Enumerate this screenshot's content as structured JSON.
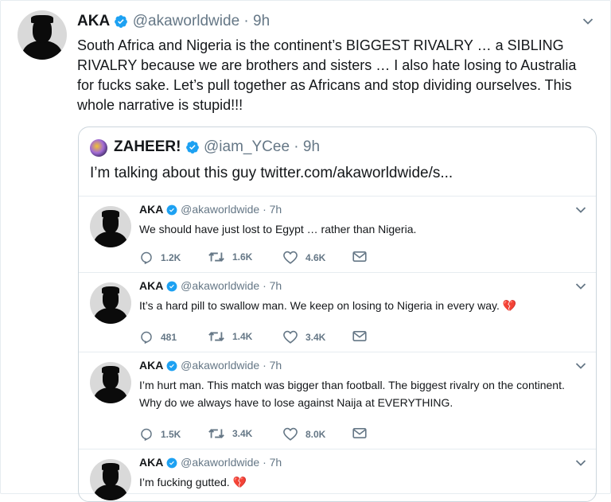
{
  "main_tweet": {
    "name": "AKA",
    "handle": "@akaworldwide",
    "sep": "·",
    "time": "9h",
    "text": "South Africa and Nigeria is the continent’s BIGGEST RIVALRY … a SIBLING RIVALRY because we are brothers and sisters  … I also hate losing to Australia for fucks sake. Let’s pull together as Africans and stop dividing ourselves. This whole narrative is stupid!!!"
  },
  "quoted_tweet": {
    "name": "ZAHEER!",
    "handle": "@iam_YCee",
    "sep": "·",
    "time": "9h",
    "text": "I’m talking about this guy twitter.com/akaworldwide/s..."
  },
  "thread": [
    {
      "name": "AKA",
      "handle": "@akaworldwide",
      "sep": "·",
      "time": "7h",
      "text": "We should have just lost to Egypt … rather than Nigeria.",
      "replies": "1.2K",
      "retweets": "1.6K",
      "likes": "4.6K"
    },
    {
      "name": "AKA",
      "handle": "@akaworldwide",
      "sep": "·",
      "time": "7h",
      "text": "It’s a hard pill to swallow man. We keep on losing to Nigeria in every way. 💔",
      "replies": "481",
      "retweets": "1.4K",
      "likes": "3.4K"
    },
    {
      "name": "AKA",
      "handle": "@akaworldwide",
      "sep": "·",
      "time": "7h",
      "text": "I’m hurt man. This match was bigger than football. The biggest rivalry on the continent. Why do we always have to lose against Naija at EVERYTHING.",
      "replies": "1.5K",
      "retweets": "3.4K",
      "likes": "8.0K"
    },
    {
      "name": "AKA",
      "handle": "@akaworldwide",
      "sep": "·",
      "time": "7h",
      "text": "I’m fucking gutted. 💔"
    }
  ],
  "icons": {
    "verified": "verified-badge-icon",
    "chevron": "chevron-down-icon",
    "reply": "reply-icon",
    "retweet": "retweet-icon",
    "like": "like-icon",
    "dm": "direct-message-icon"
  },
  "colors": {
    "accent": "#1da1f2",
    "muted": "#657786",
    "border": "#e6ecf0"
  }
}
